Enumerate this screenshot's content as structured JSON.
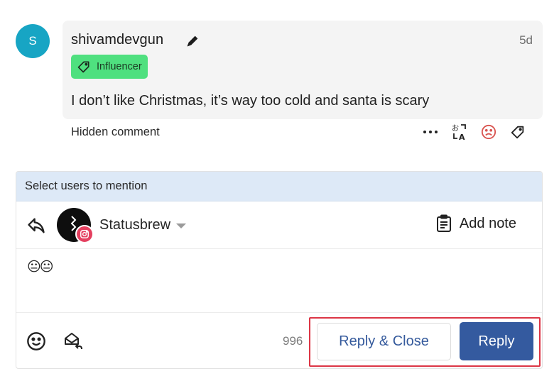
{
  "comment": {
    "avatar_initial": "S",
    "username": "shivamdevgun",
    "time": "5d",
    "tag": "Influencer",
    "text": "I don’t like Christmas, it’s way too cold and santa is scary",
    "status": "Hidden comment",
    "actions": [
      "more-options",
      "translate",
      "negative-sentiment",
      "tag"
    ]
  },
  "composer": {
    "mention_prompt": "Select users to mention",
    "account_name": "Statusbrew",
    "account_network": "instagram",
    "add_note_label": "Add note",
    "editor_value": "😐😐",
    "char_count": "996",
    "reply_close_label": "Reply & Close",
    "reply_label": "Reply"
  },
  "colors": {
    "avatar": "#17a5c4",
    "tag_badge": "#4fe07f",
    "mention_bar": "#dde9f7",
    "primary_button": "#345a9f",
    "highlight": "#dc3545",
    "sentiment_negative": "#d9534f"
  }
}
